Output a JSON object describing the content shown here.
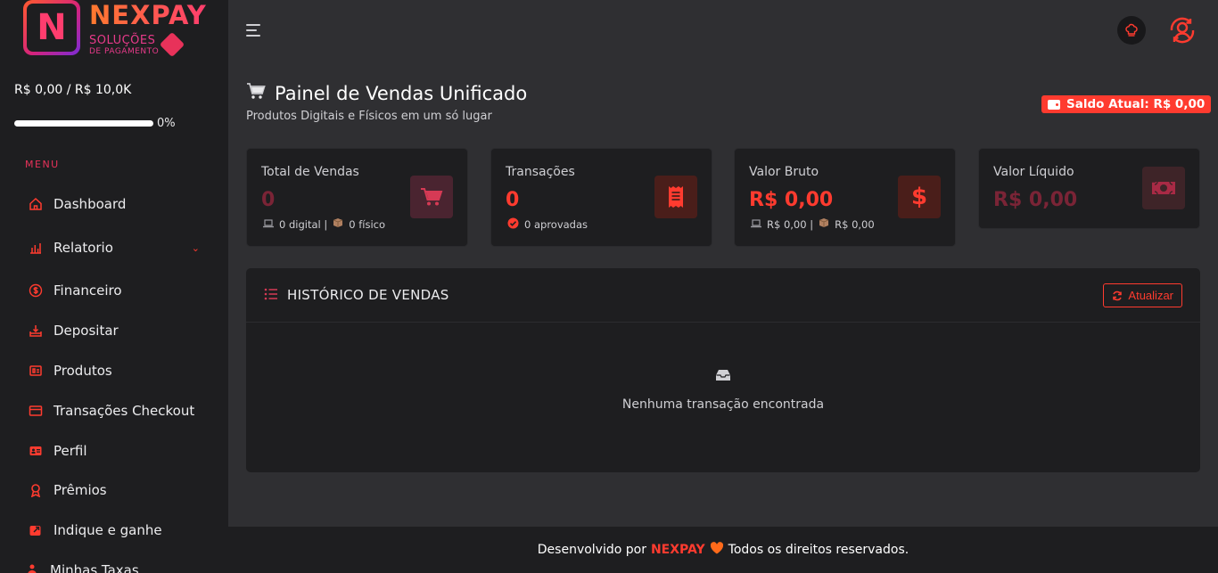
{
  "logo": {
    "mark": "N",
    "name": "NEXPAY",
    "sub1": "SOLUÇÕES",
    "sub2": "DE PAGAMENTO"
  },
  "sidebar": {
    "balance": "R$ 0,00 / R$ 10,0K",
    "progress": {
      "fraction": 0,
      "label": "0%"
    },
    "menu_title": "MENU",
    "items": [
      {
        "label": "Dashboard",
        "icon": "home-icon"
      },
      {
        "label": "Relatorio",
        "icon": "bar-chart-icon",
        "has_chevron": true
      },
      {
        "label": "Financeiro",
        "icon": "dollar-circle-icon"
      },
      {
        "label": "Depositar",
        "icon": "deposit-tray-icon"
      },
      {
        "label": "Produtos",
        "icon": "product-box-icon"
      },
      {
        "label": "Transações Checkout",
        "icon": "credit-card-icon"
      },
      {
        "label": "Perfil",
        "icon": "id-card-icon"
      },
      {
        "label": "Prêmios",
        "icon": "award-icon"
      },
      {
        "label": "Indique e ganhe",
        "icon": "share-icon"
      },
      {
        "label": "Minhas Taxas",
        "icon": "user-fee-icon"
      }
    ]
  },
  "topbar": {
    "icons": [
      "menu-icon",
      "chef-hat-icon",
      "user-sync-icon"
    ]
  },
  "page": {
    "title": "Painel de Vendas Unificado",
    "subtitle": "Produtos Digitais e Físicos em um só lugar",
    "saldo": "Saldo Atual: R$ 0,00"
  },
  "cards": [
    {
      "label": "Total de Vendas",
      "value": "0",
      "foot": "0 digital |",
      "foot2": "0 físico",
      "icon": "cart-icon"
    },
    {
      "label": "Transações",
      "value": "0",
      "foot": "0 aprovadas",
      "icon": "receipt-icon"
    },
    {
      "label": "Valor Bruto",
      "value": "R$ 0,00",
      "foot": "R$ 0,00 |",
      "foot2": "R$ 0,00",
      "icon": "dollar-icon"
    },
    {
      "label": "Valor Líquido",
      "value": "R$ 0,00",
      "icon": "money-bill-icon"
    }
  ],
  "history": {
    "title": "HISTÓRICO DE VENDAS",
    "refresh": "Atualizar",
    "empty": "Nenhuma transação encontrada"
  },
  "footer": {
    "prefix": "Desenvolvido por",
    "brand": "NEXPAY",
    "suffix": "Todos os direitos reservados."
  },
  "colors": {
    "accent": "#ff3b2f",
    "pink": "#e8325a",
    "sidebar": "#1e1e20",
    "background": "#2f2f32"
  }
}
